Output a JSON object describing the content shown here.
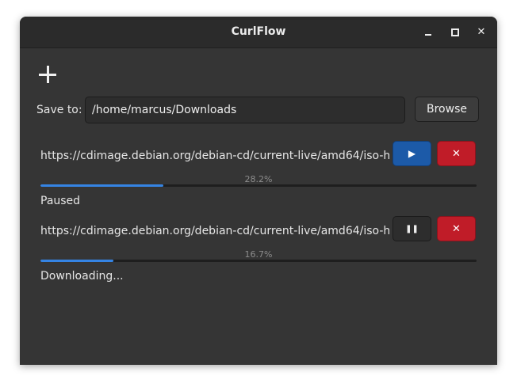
{
  "window": {
    "title": "CurlFlow",
    "minimize_icon": "minimize-icon",
    "maximize_icon": "maximize-icon",
    "close_glyph": "✕"
  },
  "toolbar": {
    "add_icon": "plus-icon"
  },
  "save": {
    "label": "Save to:",
    "path": "/home/marcus/Downloads",
    "browse_label": "Browse"
  },
  "downloads": [
    {
      "url": "https://cdimage.debian.org/debian-cd/current-live/amd64/iso-h...",
      "percent_label": "28.2%",
      "progress": 0.282,
      "status": "Paused",
      "action": "play",
      "action_glyph": "▶",
      "cancel_glyph": "✕"
    },
    {
      "url": "https://cdimage.debian.org/debian-cd/current-live/amd64/iso-h...",
      "percent_label": "16.7%",
      "progress": 0.167,
      "status": "Downloading...",
      "action": "pause",
      "action_glyph": "❚❚",
      "cancel_glyph": "✕"
    }
  ],
  "colors": {
    "accent": "#3584e4",
    "play_button": "#1c5aa8",
    "cancel_button": "#c01c28",
    "window_bg": "#353535",
    "titlebar_bg": "#2b2b2b"
  }
}
